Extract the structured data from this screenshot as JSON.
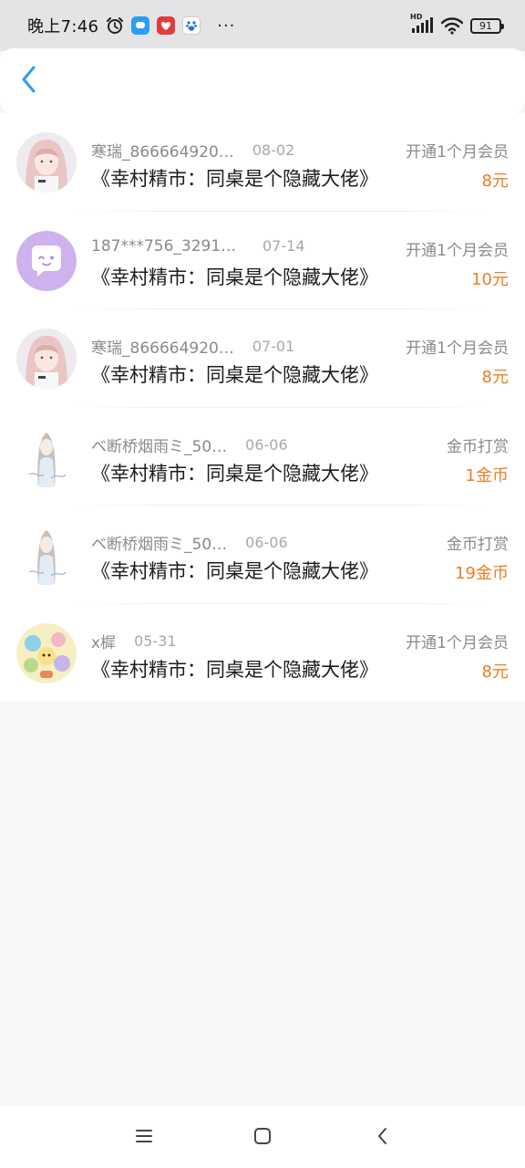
{
  "status_bar": {
    "time": "晚上7:46",
    "network_label": "HD",
    "battery": "91",
    "icons": [
      "alarm-icon",
      "chat-app-icon",
      "red-app-icon",
      "baidu-app-icon",
      "more-dots-icon",
      "signal-icon",
      "wifi-icon",
      "battery-icon"
    ],
    "dots": "···"
  },
  "header": {
    "back_icon": "chevron-left-icon",
    "accent_color": "#2a9df4"
  },
  "records": [
    {
      "user": "寒瑞_866664920…",
      "date": "08-02",
      "book": "《幸村精市：同桌是个隐藏大佬》",
      "action": "开通1个月会员",
      "amount": "8元",
      "avatar": "anime-girl-pink"
    },
    {
      "user": "187***756_32916…",
      "date": "07-14",
      "book": "《幸村精市：同桌是个隐藏大佬》",
      "action": "开通1个月会员",
      "amount": "10元",
      "avatar": "default-purple"
    },
    {
      "user": "寒瑞_866664920…",
      "date": "07-01",
      "book": "《幸村精市：同桌是个隐藏大佬》",
      "action": "开通1个月会员",
      "amount": "8元",
      "avatar": "anime-girl-pink"
    },
    {
      "user": "ベ断桥烟雨ミ_50…",
      "date": "06-06",
      "book": "《幸村精市：同桌是个隐藏大佬》",
      "action": "金币打赏",
      "amount": "1金币",
      "avatar": "sketch-girl"
    },
    {
      "user": "ベ断桥烟雨ミ_50…",
      "date": "06-06",
      "book": "《幸村精市：同桌是个隐藏大佬》",
      "action": "金币打赏",
      "amount": "19金币",
      "avatar": "sketch-girl"
    },
    {
      "user": "x樨",
      "date": "05-31",
      "book": "《幸村精市：同桌是个隐藏大佬》",
      "action": "开通1个月会员",
      "amount": "8元",
      "avatar": "cartoon-collage"
    }
  ],
  "colors": {
    "amount": "#ee7d22",
    "secondary_text": "#8a8a8a",
    "primary_text": "#1c1c1c",
    "page_background": "#f8f7f8"
  },
  "nav_bar": {
    "icons": [
      "menu-icon",
      "home-square-icon",
      "back-triangle-icon"
    ]
  }
}
